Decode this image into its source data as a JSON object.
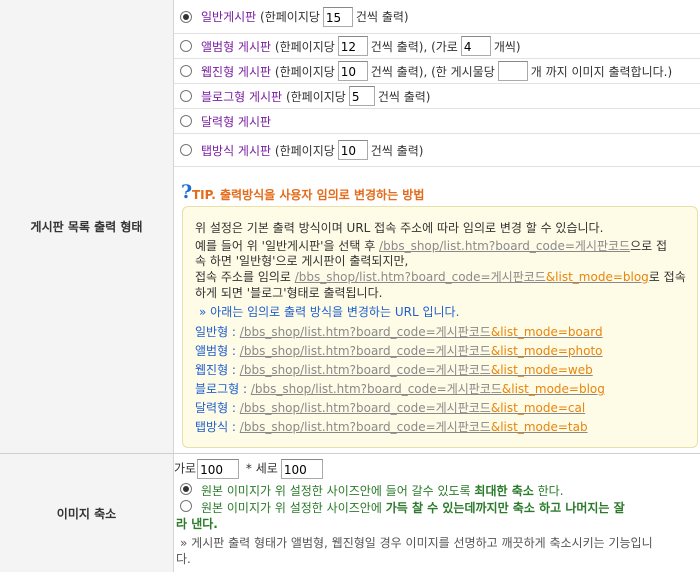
{
  "row1_label": "게시판 목록 출력 형태",
  "row2_label": "이미지 축소",
  "options": [
    {
      "name": "일반게시판",
      "pre": "(한페이지당",
      "v1": "15",
      "mid": "건씩 출력)",
      "extra": "",
      "v2": "",
      "post": ""
    },
    {
      "name": "앨범형 게시판",
      "pre": "(한페이지당",
      "v1": "12",
      "mid": "건씩 출력), (가로",
      "extra": "",
      "v2": "4",
      "post": "개씩)"
    },
    {
      "name": "웹진형 게시판",
      "pre": "(한페이지당",
      "v1": "10",
      "mid": "건씩 출력), (한 게시물당",
      "extra": "",
      "v2": "",
      "post": "개 까지 이미지 출력합니다.)"
    },
    {
      "name": "블로그형 게시판",
      "pre": "(한페이지당",
      "v1": "5",
      "mid": "건씩 출력)",
      "extra": "",
      "v2": "",
      "post": ""
    },
    {
      "name": "달력형 게시판",
      "pre": "",
      "v1": "",
      "mid": "",
      "extra": "",
      "v2": "",
      "post": ""
    },
    {
      "name": "탭방식 게시판",
      "pre": "(한페이지당",
      "v1": "10",
      "mid": "건씩 출력)",
      "extra": "",
      "v2": "",
      "post": ""
    }
  ],
  "tip": {
    "title": "TIP. 출력방식을 사용자 임의로 변경하는 방법",
    "l1": "위 설정은 기본 출력 방식이며 URL 접속 주소에 따라 임의로 변경 할 수 있습니다.",
    "l2a": "예를 들어 위 '일반게시판'을 선택 후 ",
    "l2url": "/bbs_shop/list.htm?board_code=게시판코드",
    "l2b": "으로 접",
    "l3": "속 하면 '일반형'으로 게시판이 출력되지만,",
    "l4a": "접속 주소를 임의로 ",
    "l4url": "/bbs_shop/list.htm?board_code=게시판코드",
    "l4o": "&list_mode=blog",
    "l4b": "로 접속",
    "l5": "하게 되면 '블로그'형태로 출력됩니다.",
    "sub": "» 아래는 임의로 출력 방식을 변경하는 URL 입니다.",
    "links": [
      {
        "k": "일반형 : ",
        "u": "/bbs_shop/list.htm?board_code=게시판코드",
        "o": "&list_mode=board"
      },
      {
        "k": "앨범형 : ",
        "u": "/bbs_shop/list.htm?board_code=게시판코드",
        "o": "&list_mode=photo"
      },
      {
        "k": "웹진형 : ",
        "u": "/bbs_shop/list.htm?board_code=게시판코드",
        "o": "&list_mode=web"
      },
      {
        "k": "블로그형 : ",
        "u": "/bbs_shop/list.htm?board_code=게시판코드",
        "o": "&list_mode=blog"
      },
      {
        "k": "달력형 : ",
        "u": "/bbs_shop/list.htm?board_code=게시판코드",
        "o": "&list_mode=cal"
      },
      {
        "k": "탭방식 : ",
        "u": "/bbs_shop/list.htm?board_code=게시판코드",
        "o": "&list_mode=tab"
      }
    ]
  },
  "resize": {
    "w_label": "가로",
    "w": "100",
    "x_label": "* 세로",
    "h": "100",
    "opt1a": "원본 이미지가 위 설정한 사이즈안에 들어 갈수 있도록 ",
    "opt1b": "최대한 축소",
    "opt1c": " 한다.",
    "opt2a": "원본 이미지가 위 설정한 사이즈안에 ",
    "opt2b": "가득 찰 수 있는데까지만 축소 하고 나머지는 잘",
    "opt2c": "라 낸다.",
    "note1": "» 게시판 출력 형태가 앨범형, 웹진형일 경우 이미지를 선명하고 깨끗하게 축소시키는 기능입니",
    "note2": "다."
  }
}
